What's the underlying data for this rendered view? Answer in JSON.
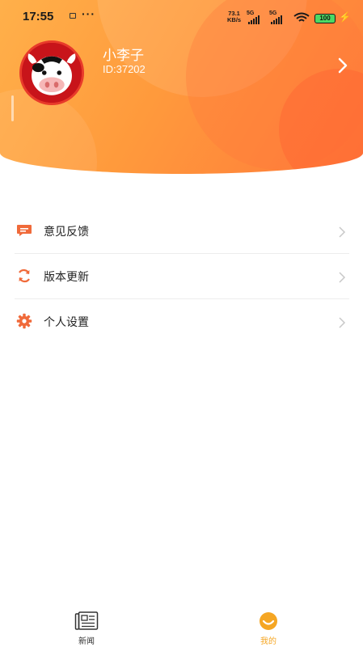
{
  "status_bar": {
    "time": "17:55",
    "more": "···",
    "net_speed_value": "73.1",
    "net_speed_unit": "KB/s",
    "signal_1_label": "5G",
    "signal_2_label": "5G",
    "battery": "100"
  },
  "profile": {
    "name": "小李子",
    "id": "ID:37202"
  },
  "menu": {
    "items": [
      {
        "label": "意见反馈",
        "icon": "feedback-icon"
      },
      {
        "label": "版本更新",
        "icon": "refresh-icon"
      },
      {
        "label": "个人设置",
        "icon": "gear-icon"
      }
    ]
  },
  "tabbar": {
    "tabs": [
      {
        "label": "新闻",
        "icon": "newspaper-icon",
        "active": false
      },
      {
        "label": "我的",
        "icon": "smile-icon",
        "active": true
      }
    ]
  },
  "colors": {
    "accent": "#f5a623",
    "header_start": "#ffb04a",
    "header_end": "#ff7a3a",
    "icon": "#f06a3a"
  }
}
